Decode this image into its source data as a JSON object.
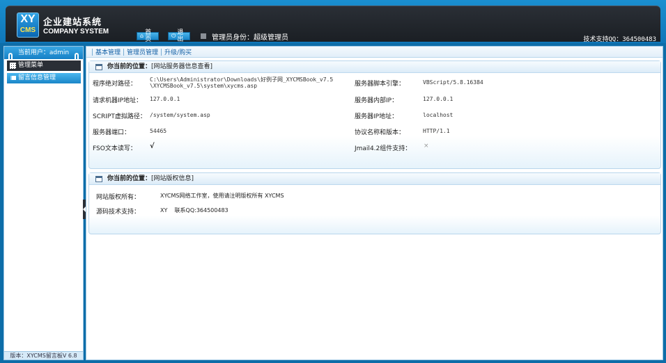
{
  "header": {
    "logo_top": "XY",
    "logo_bottom": "CMS",
    "brand_cn": "企业建站系统",
    "brand_en": "COMPANY SYSTEM",
    "home_label": "首页",
    "logout_label": "退出",
    "admin_identity": "管理员身份：超级管理员",
    "support": "技术支持QQ：364500483"
  },
  "sidebar": {
    "current_user": "当前用户：admin",
    "menu_title": "管理菜单",
    "items": [
      {
        "label": "留言信息管理"
      }
    ],
    "version": "版本：XYCMS留言板V 6.8"
  },
  "topnav": {
    "items": [
      {
        "label": "基本管理"
      },
      {
        "label": "管理员管理"
      },
      {
        "label": "升级/购买"
      }
    ]
  },
  "server_panel": {
    "loc_label": "你当前的位置：",
    "loc_value": "[网站服务器信息查看]",
    "rows": [
      {
        "label": "程序绝对路径：",
        "value1": "C:\\Users\\Administrator\\Downloads\\好例子网_XYCMSBook_v7.5",
        "value2": "\\XYCMSBook_v7.5\\system\\xycms.asp"
      },
      {
        "label": "服务器脚本引擎：",
        "value": "VBScript/5.8.16384"
      },
      {
        "label": "请求机器IP地址：",
        "value": "127.0.0.1"
      },
      {
        "label": "服务器内部IP：",
        "value": "127.0.0.1"
      },
      {
        "label": "SCRIPT虚拟路径：",
        "value": "/system/system.asp"
      },
      {
        "label": "服务器IP地址：",
        "value": "localhost"
      },
      {
        "label": "服务器端口：",
        "value": "54465"
      },
      {
        "label": "协议名称和版本：",
        "value": "HTTP/1.1"
      },
      {
        "label": "FSO文本读写：",
        "value": "√"
      },
      {
        "label": "Jmail4.2组件支持：",
        "value": "×"
      }
    ]
  },
  "copyright_panel": {
    "loc_label": "你当前的位置：",
    "loc_value": "[网站版权信息]",
    "rows": [
      {
        "label": "网站版权所有：",
        "value": "XYCMS网络工作室，使用请注明版权所有 XYCMS"
      },
      {
        "label": "源码技术支持：",
        "value": "XY    联系QQ:364500483"
      }
    ]
  }
}
